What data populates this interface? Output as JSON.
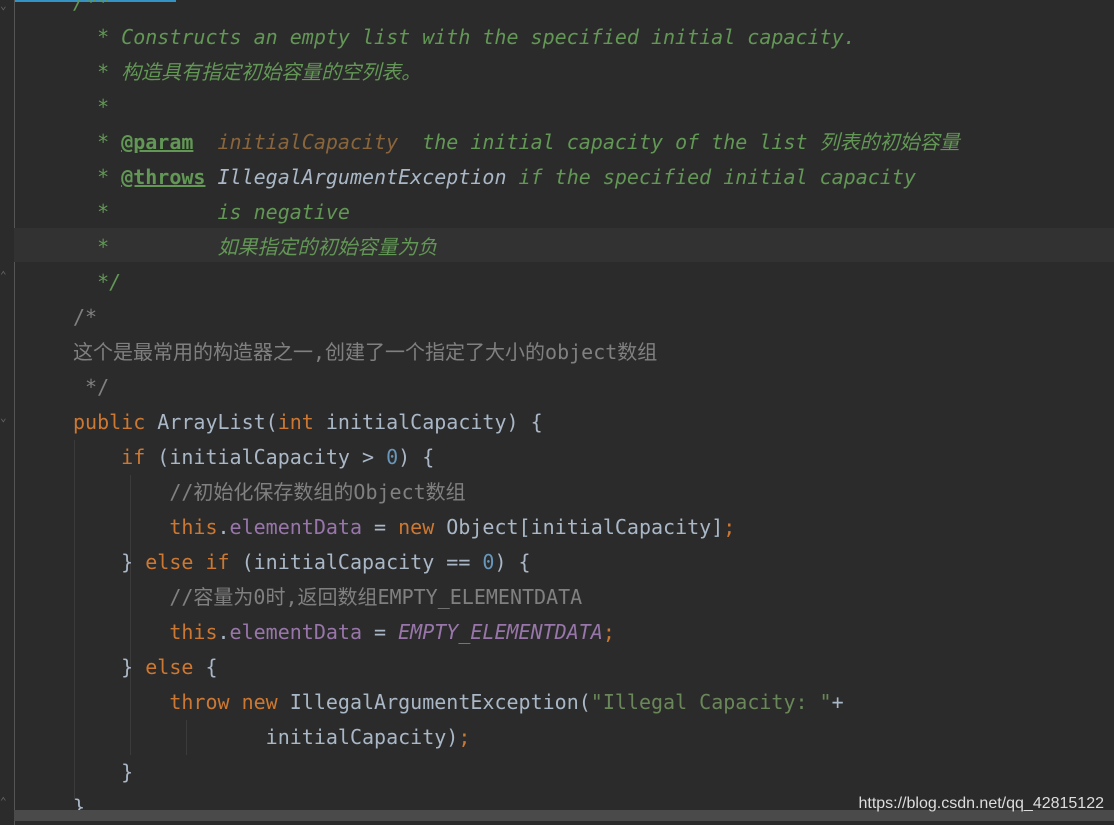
{
  "editor": {
    "colors": {
      "background": "#2b2b2b",
      "doc_comment": "#629755",
      "keyword": "#cc7832",
      "field": "#9876aa",
      "number": "#6897bb",
      "string": "#6a8759",
      "line_comment": "#808080",
      "text": "#a9b7c6"
    },
    "lines": [
      [
        {
          "t": "/**",
          "c": "doc"
        }
      ],
      [
        {
          "t": "  * Constructs an empty list with the specified initial capacity.",
          "c": "doc"
        }
      ],
      [
        {
          "t": "  * 构造具有指定初始容量的空列表。",
          "c": "doc"
        }
      ],
      [
        {
          "t": "  *",
          "c": "doc"
        }
      ],
      [
        {
          "t": "  * ",
          "c": "doc"
        },
        {
          "t": "@param",
          "c": "tag"
        },
        {
          "t": "  ",
          "c": "doc"
        },
        {
          "t": "initialCapacity",
          "c": "prm"
        },
        {
          "t": "  the initial capacity of the list 列表的初始容量",
          "c": "doc"
        }
      ],
      [
        {
          "t": "  * ",
          "c": "doc"
        },
        {
          "t": "@throws",
          "c": "tag"
        },
        {
          "t": " ",
          "c": "doc"
        },
        {
          "t": "IllegalArgumentException",
          "c": "cls"
        },
        {
          "t": " if the specified initial capacity",
          "c": "doc"
        }
      ],
      [
        {
          "t": "  *         is negative",
          "c": "doc"
        }
      ],
      [
        {
          "t": "  *         如果指定的初始容量为负",
          "c": "doc"
        }
      ],
      [
        {
          "t": "  */",
          "c": "doc"
        }
      ],
      [
        {
          "t": "/*",
          "c": "cmt"
        }
      ],
      [
        {
          "t": "这个是最常用的构造器之一,创建了一个指定了大小的object数组",
          "c": "cmt"
        }
      ],
      [
        {
          "t": " */",
          "c": "cmt"
        }
      ],
      [
        {
          "t": "public ",
          "c": "kw"
        },
        {
          "t": "ArrayList",
          "c": "pl"
        },
        {
          "t": "(",
          "c": "pl"
        },
        {
          "t": "int ",
          "c": "kw"
        },
        {
          "t": "initialCapacity) {",
          "c": "pl"
        }
      ],
      [
        {
          "t": "    if ",
          "c": "kw"
        },
        {
          "t": "(initialCapacity > ",
          "c": "pl"
        },
        {
          "t": "0",
          "c": "num"
        },
        {
          "t": ") {",
          "c": "pl"
        }
      ],
      [
        {
          "t": "        //初始化保存数组的Object数组",
          "c": "cmt"
        }
      ],
      [
        {
          "t": "        this",
          "c": "kw"
        },
        {
          "t": ".",
          "c": "pl"
        },
        {
          "t": "elementData",
          "c": "fld"
        },
        {
          "t": " = ",
          "c": "pl"
        },
        {
          "t": "new ",
          "c": "kw"
        },
        {
          "t": "Object[initialCapacity]",
          "c": "pl"
        },
        {
          "t": ";",
          "c": "kw"
        }
      ],
      [
        {
          "t": "    } ",
          "c": "pl"
        },
        {
          "t": "else if ",
          "c": "kw"
        },
        {
          "t": "(initialCapacity == ",
          "c": "pl"
        },
        {
          "t": "0",
          "c": "num"
        },
        {
          "t": ") {",
          "c": "pl"
        }
      ],
      [
        {
          "t": "        //容量为0时,返回数组EMPTY_ELEMENTDATA",
          "c": "cmt"
        }
      ],
      [
        {
          "t": "        this",
          "c": "kw"
        },
        {
          "t": ".",
          "c": "pl"
        },
        {
          "t": "elementData",
          "c": "fld"
        },
        {
          "t": " = ",
          "c": "pl"
        },
        {
          "t": "EMPTY_ELEMENTDATA",
          "c": "sfld"
        },
        {
          "t": ";",
          "c": "kw"
        }
      ],
      [
        {
          "t": "    } ",
          "c": "pl"
        },
        {
          "t": "else ",
          "c": "kw"
        },
        {
          "t": "{",
          "c": "pl"
        }
      ],
      [
        {
          "t": "        throw new ",
          "c": "kw"
        },
        {
          "t": "IllegalArgumentException(",
          "c": "pl"
        },
        {
          "t": "\"Illegal Capacity: \"",
          "c": "str"
        },
        {
          "t": "+",
          "c": "pl"
        }
      ],
      [
        {
          "t": "                initialCapacity)",
          "c": "pl"
        },
        {
          "t": ";",
          "c": "kw"
        }
      ],
      [
        {
          "t": "    }",
          "c": "pl"
        }
      ],
      [
        {
          "t": "}",
          "c": "pl"
        }
      ]
    ]
  },
  "watermark": "https://blog.csdn.net/qq_42815122"
}
